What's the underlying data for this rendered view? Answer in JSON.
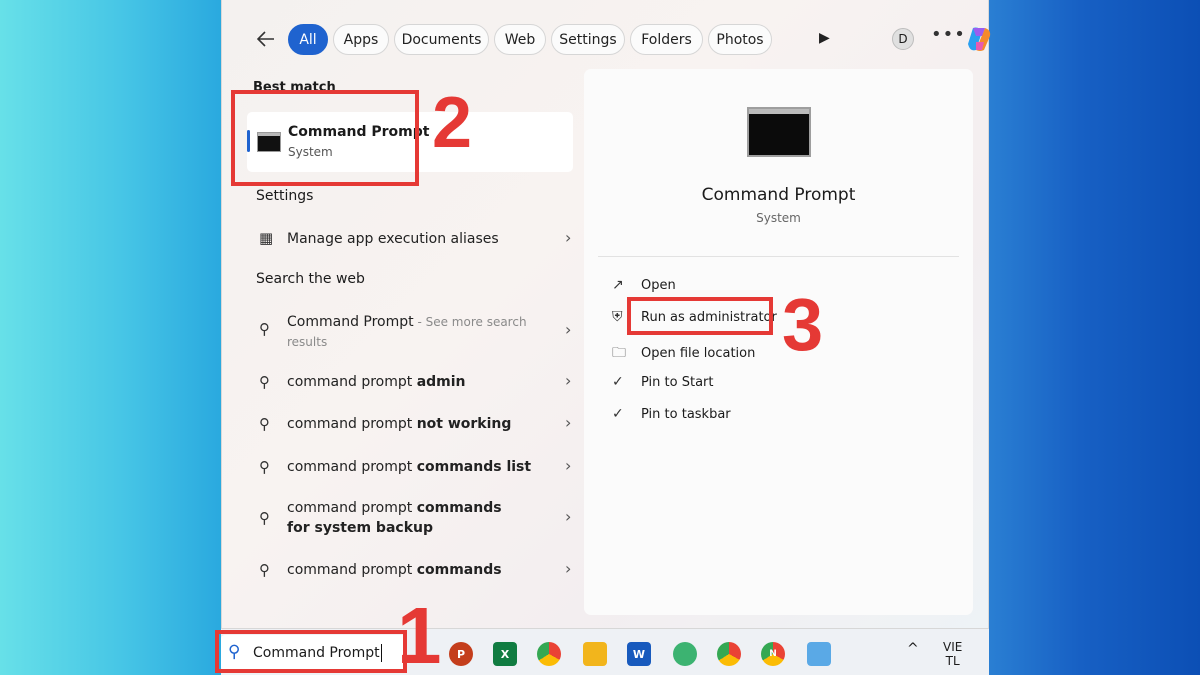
{
  "filters": {
    "chips": [
      "All",
      "Apps",
      "Documents",
      "Web",
      "Settings",
      "Folders",
      "Photos"
    ],
    "active": "All",
    "account_initial": "D",
    "more": "•••"
  },
  "left": {
    "best_match_heading": "Best match",
    "best_match": {
      "title": "Command Prompt",
      "subtitle": "System"
    },
    "settings_heading": "Settings",
    "settings_item": "Manage app execution aliases",
    "web_heading": "Search the web",
    "web_items": [
      {
        "prefix": "Command Prompt",
        "bold": "",
        "suffix": " - See more search results"
      },
      {
        "prefix": "command prompt ",
        "bold": "admin",
        "suffix": ""
      },
      {
        "prefix": "command prompt ",
        "bold": "not working",
        "suffix": ""
      },
      {
        "prefix": "command prompt ",
        "bold": "commands list",
        "suffix": ""
      },
      {
        "prefix": "command prompt ",
        "bold": "commands for system backup",
        "suffix": ""
      },
      {
        "prefix": "command prompt ",
        "bold": "commands",
        "suffix": ""
      }
    ]
  },
  "right": {
    "title": "Command Prompt",
    "subtitle": "System",
    "actions": [
      "Open",
      "Run as administrator",
      "Open file location",
      "Pin to Start",
      "Pin to taskbar"
    ]
  },
  "annotations": {
    "step1": "1",
    "step2": "2",
    "step3": "3"
  },
  "taskbar": {
    "search_value": "Command Prompt",
    "apps": [
      "P",
      "X",
      "",
      "",
      "W",
      "",
      "",
      "N",
      ""
    ],
    "tray_lang_top": "VIE",
    "tray_lang_bottom": "TL",
    "chevron": "^"
  },
  "colors": {
    "accent": "#1f63cf",
    "annotation_red": "#e53935"
  }
}
